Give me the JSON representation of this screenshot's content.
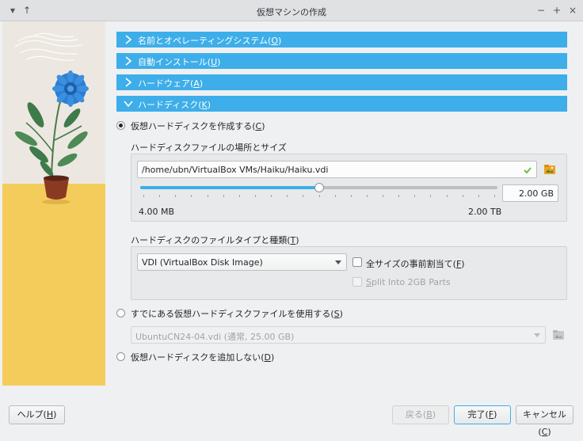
{
  "window": {
    "title": "仮想マシンの作成",
    "controls": [
      "−",
      "+",
      "×"
    ],
    "menu_glyphs": [
      "▾",
      "↑"
    ]
  },
  "sections": [
    {
      "label": "名前とオペレーティングシステム(",
      "mnemonic": "O",
      "suffix": ")",
      "expanded": false
    },
    {
      "label": "自動インストール(",
      "mnemonic": "U",
      "suffix": ")",
      "expanded": false
    },
    {
      "label": "ハードウェア(",
      "mnemonic": "A",
      "suffix": ")",
      "expanded": false
    },
    {
      "label": "ハードディスク(",
      "mnemonic": "K",
      "suffix": ")",
      "expanded": true
    }
  ],
  "create_disk": {
    "label": "仮想ハードディスクを作成する(",
    "mnemonic": "C",
    "suffix": ")",
    "selected": true,
    "location_heading": "ハードディスクファイルの場所とサイズ",
    "path_value": "/home/ubn/VirtualBox VMs/Haiku/Haiku.vdi",
    "size_value": "2.00 GB",
    "size_fraction": 0.5,
    "min_label": "4.00 MB",
    "max_label": "2.00 TB",
    "type_heading": "ハードディスクのファイルタイプと種類(",
    "type_mnemonic": "T",
    "type_suffix": ")",
    "type_selected": "VDI (VirtualBox Disk Image)",
    "prealloc_label": "全サイズの事前割当て(",
    "prealloc_mnemonic": "F",
    "prealloc_suffix": ")",
    "prealloc_checked": false,
    "split_label": "Split Into 2GB Parts",
    "split_mnemonic": "S",
    "split_rest": "plit Into 2GB Parts",
    "split_checked": false
  },
  "use_existing": {
    "label": "すでにある仮想ハードディスクファイルを使用する(",
    "mnemonic": "S",
    "suffix": ")",
    "selected": false,
    "combo_value": "UbuntuCN24-04.vdi (通常, 25.00 GB)"
  },
  "no_disk": {
    "label": "仮想ハードディスクを追加しない(",
    "mnemonic": "D",
    "suffix": ")",
    "selected": false
  },
  "buttons": {
    "help": {
      "label": "ヘルプ(",
      "mnemonic": "H",
      "suffix": ")"
    },
    "back": {
      "label": "戻る(",
      "mnemonic": "B",
      "suffix": ")"
    },
    "finish": {
      "label": "完了(",
      "mnemonic": "F",
      "suffix": ")"
    },
    "cancel": {
      "label": "キャンセル(",
      "mnemonic": "C",
      "suffix": ")"
    }
  },
  "colors": {
    "accent": "#3daee9",
    "valid_check": "#6dbf44",
    "folder_icon": "#f0a020"
  }
}
